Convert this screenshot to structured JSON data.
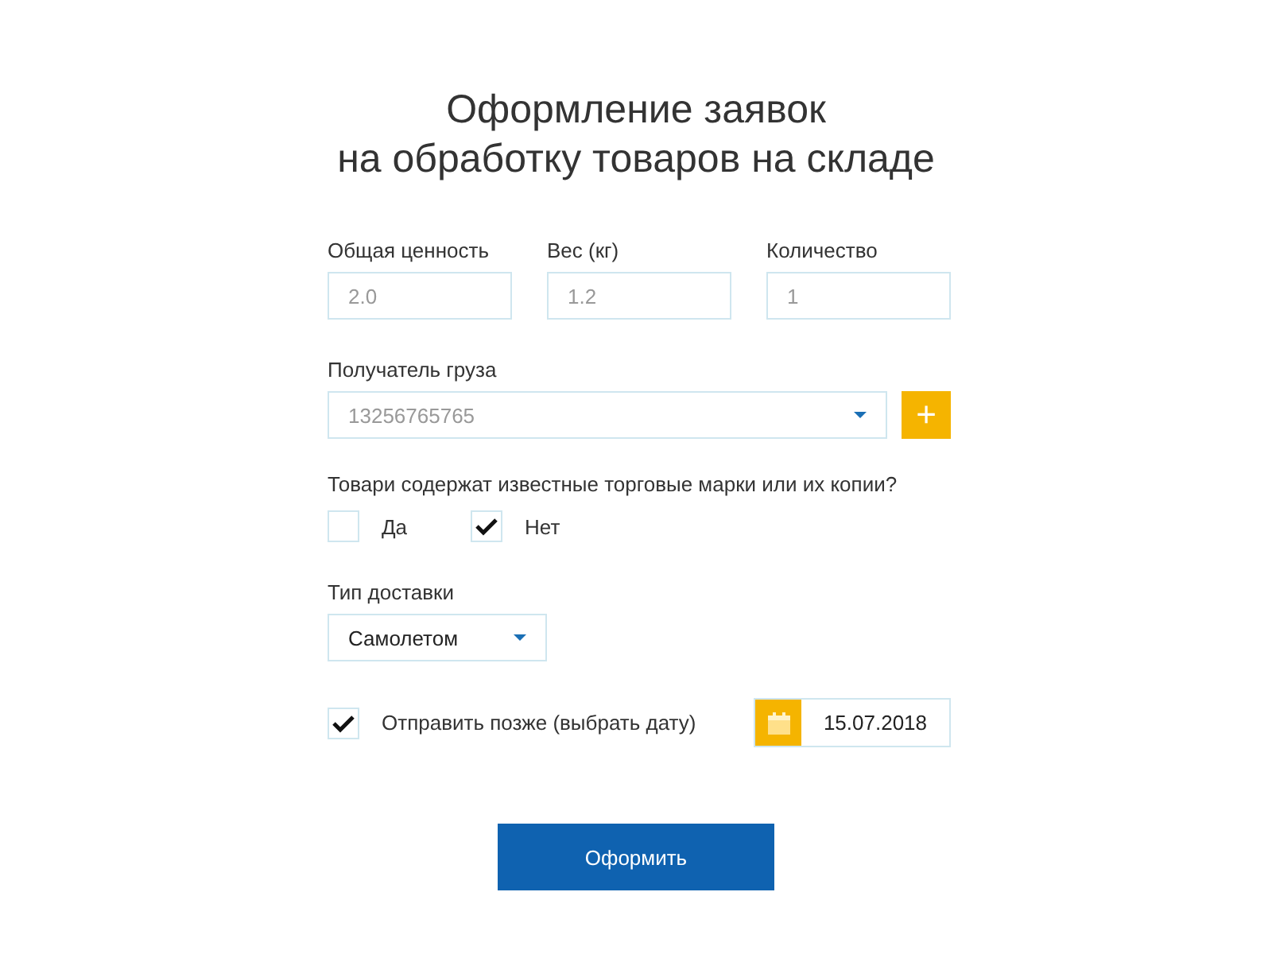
{
  "title_lines": [
    "Оформление заявок",
    "на обработку товаров на складе"
  ],
  "fields": [
    {
      "label": "Общая ценность",
      "placeholder": "2.0"
    },
    {
      "label": "Вес (кг)",
      "placeholder": "1.2"
    },
    {
      "label": "Количество",
      "placeholder": "1"
    }
  ],
  "recipient": {
    "label": "Получатель груза",
    "placeholder": "13256765765",
    "add_button": "+"
  },
  "question": {
    "text": "Товари содержат известные торговые марки или их копии?",
    "options": [
      {
        "label": "Да",
        "checked": false
      },
      {
        "label": "Нет",
        "checked": true
      }
    ]
  },
  "delivery": {
    "label": "Тип доставки",
    "value": "Самолетом"
  },
  "send_later": {
    "label": "Отправить позже (выбрать дату)",
    "checked": true,
    "date": "15.07.2018"
  },
  "submit": "Оформить"
}
